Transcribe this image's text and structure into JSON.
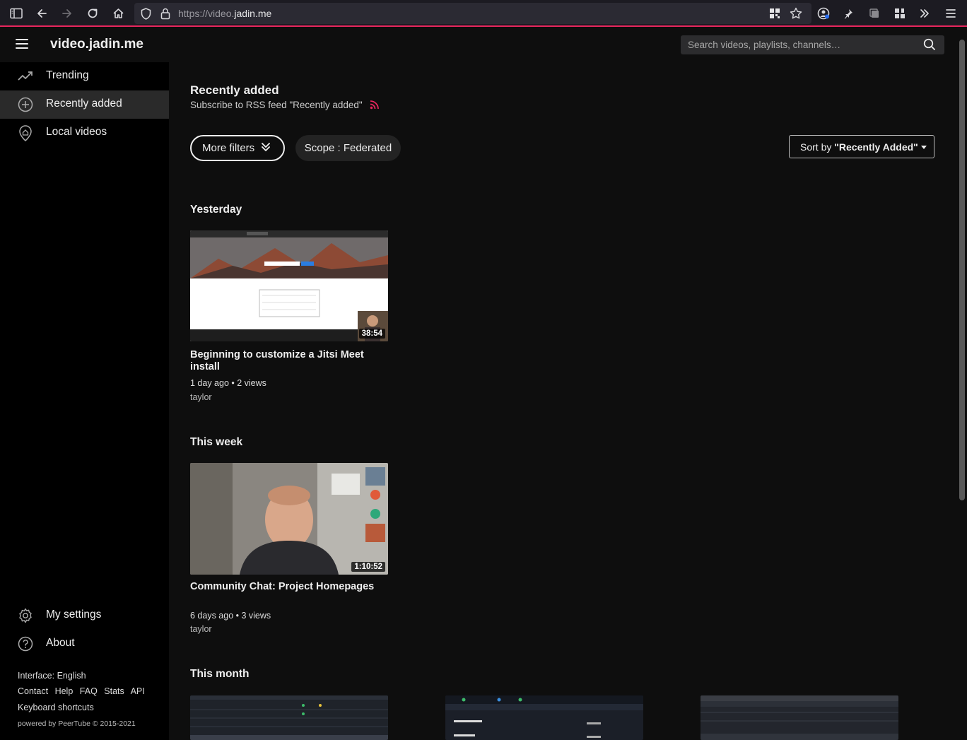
{
  "browser": {
    "url_prefix": "https://video.",
    "url_domain": "jadin.me",
    "accent": "#e7265e"
  },
  "header": {
    "site_title": "video.jadin.me",
    "search_placeholder": "Search videos, playlists, channels…"
  },
  "sidebar": {
    "items": [
      {
        "label": "Trending",
        "icon": "trending-icon"
      },
      {
        "label": "Recently added",
        "icon": "plus-circle-icon"
      },
      {
        "label": "Local videos",
        "icon": "home-pin-icon"
      }
    ],
    "bottom_items": [
      {
        "label": "My settings",
        "icon": "gear-icon"
      },
      {
        "label": "About",
        "icon": "help-icon"
      }
    ],
    "interface_lang": "Interface: English",
    "footer_links": [
      "Contact",
      "Help",
      "FAQ",
      "Stats",
      "API"
    ],
    "keyboard": "Keyboard shortcuts",
    "powered": "powered by PeerTube © 2015-2021"
  },
  "main": {
    "title": "Recently added",
    "rss": "Subscribe to RSS feed \"Recently added\"",
    "more_filters": "More filters",
    "scope": "Scope : Federated",
    "sort_prefix": "Sort by",
    "sort_value": "\"Recently Added\"",
    "sections": [
      {
        "title": "Yesterday",
        "videos": [
          {
            "title": "Beginning to customize a Jitsi Meet install",
            "meta": "1 day ago • 2 views",
            "channel": "taylor",
            "duration": "38:54"
          }
        ]
      },
      {
        "title": "This week",
        "videos": [
          {
            "title": "Community Chat: Project Homepages",
            "meta": "6 days ago • 3 views",
            "channel": "taylor",
            "duration": "1:10:52"
          }
        ]
      },
      {
        "title": "This month",
        "videos": []
      }
    ]
  }
}
